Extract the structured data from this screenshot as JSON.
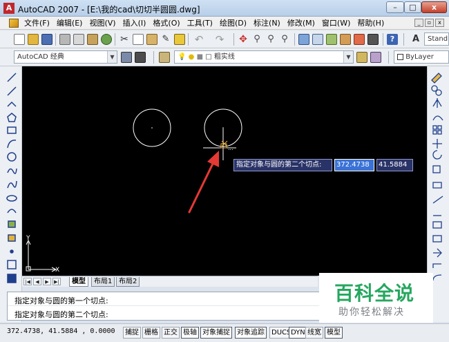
{
  "window": {
    "title": "AutoCAD 2007 - [E:\\我的cad\\切切半圆圆.dwg]",
    "app_icon": "A",
    "minimize_label": "–",
    "maximize_label": "□",
    "close_label": "x"
  },
  "menu": {
    "items": [
      "文件(F)",
      "编辑(E)",
      "视图(V)",
      "插入(I)",
      "格式(O)",
      "工具(T)",
      "绘图(D)",
      "标注(N)",
      "修改(M)",
      "窗口(W)",
      "帮助(H)"
    ]
  },
  "toolbar": {
    "style_combo": "Stand",
    "workspace_combo": "AutoCAD 经典",
    "layer_combo": "粗实线",
    "color_combo": "ByLayer"
  },
  "canvas": {
    "ucs_x_label": "X",
    "ucs_y_label": "Y"
  },
  "dynamic_input": {
    "prompt": "指定对象与圆的第二个切点:",
    "x_value": "372.4738",
    "y_value": "41.5884"
  },
  "layout_tabs": [
    "模型",
    "布局1",
    "布局2"
  ],
  "command_line": {
    "line1": "指定对象与圆的第一个切点:",
    "line2": "指定对象与圆的第二个切点:"
  },
  "status_bar": {
    "coordinates": "372.4738, 41.5884 , 0.0000",
    "buttons": [
      "捕捉",
      "栅格",
      "正交",
      "极轴",
      "对象捕捉",
      "对象追踪",
      "DUCS",
      "DYN",
      "线宽",
      "模型"
    ]
  },
  "watermark": {
    "main": "百科全说",
    "sub": "助你轻松解决"
  },
  "colors": {
    "canvas_bg": "#000000",
    "circle_stroke": "#ffffff",
    "arrow": "#e53935",
    "watermark_green": "#25a75f"
  }
}
